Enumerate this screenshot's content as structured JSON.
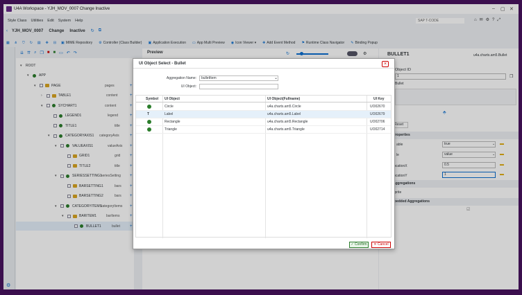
{
  "window": {
    "title": "U4A Workspace - YJH_MOV_0007 Change Inactive"
  },
  "menu": {
    "items": [
      "Style Class",
      "Utilities",
      "Edit",
      "System",
      "Help"
    ],
    "tcode_placeholder": "SAP T-CODE"
  },
  "subheader": {
    "app": "YJH_MOV_0007",
    "mode": "Change",
    "status": "Inactive"
  },
  "toolbar": {
    "items": [
      "MIME Repository",
      "Controller (Class Builder)",
      "Application Execution",
      "App Multi Preview",
      "Icon Viewer",
      "Add Event Method",
      "Runtime Class Navigator",
      "Binding Popup"
    ]
  },
  "tree": {
    "nodes": [
      {
        "label": "ROOT",
        "right": ""
      },
      {
        "label": "APP",
        "right": ""
      },
      {
        "label": "PAGE",
        "right": "pages"
      },
      {
        "label": "TABLE1",
        "right": "content"
      },
      {
        "label": "SYCHART1",
        "right": "content"
      },
      {
        "label": "LEGEND1",
        "right": "legend"
      },
      {
        "label": "TITLE1",
        "right": "title"
      },
      {
        "label": "CATEGORYAXIS1",
        "right": "categoryAxis"
      },
      {
        "label": "VALUEAXIS1",
        "right": "valueAxis"
      },
      {
        "label": "GRID1",
        "right": "grid"
      },
      {
        "label": "TITLE2",
        "right": "title"
      },
      {
        "label": "SERIESSETTING1",
        "right": "seriesSetting"
      },
      {
        "label": "BARSETTING1",
        "right": "bars"
      },
      {
        "label": "BARSETTING2",
        "right": "bars"
      },
      {
        "label": "CATEGORYITEMS",
        "right": "categoryItems"
      },
      {
        "label": "BARITEM1",
        "right": "barItems"
      },
      {
        "label": "BULLET1",
        "right": "bullet"
      }
    ]
  },
  "preview": {
    "title": "Preview"
  },
  "right_panel": {
    "title": "BULLET1",
    "class_name": "u4a.charts.am5.Bullet",
    "object_id_label": "Object ID",
    "object_id_value": "1",
    "sub_value": "Bullet",
    "reset_label": "Reset",
    "properties_label": "Properties",
    "props": [
      {
        "name": "able",
        "value": "true"
      },
      {
        "name": "le",
        "value": "value"
      },
      {
        "name": "locationX",
        "value": "0.5"
      },
      {
        "name": "locationY",
        "value": "1"
      }
    ],
    "aggregations_label": "Aggregations",
    "agg_item": "sprite",
    "embedded_label": "Embedded Aggregations"
  },
  "dialog": {
    "title": "UI Object Select - Bullet",
    "aggregation_label": "Aggregation Name:",
    "aggregation_value": "bulletItem",
    "uiobject_label": "UI Object:",
    "uiobject_value": "",
    "columns": [
      "Symbol",
      "UI Object",
      "UI Object(Fullname)",
      "UI Key"
    ],
    "rows": [
      {
        "symbol": "green-circle",
        "name": "Circle",
        "fullname": "u4a.charts.am5.Circle",
        "key": "UO02670"
      },
      {
        "symbol": "text-T",
        "name": "Label",
        "fullname": "u4a.charts.am5.Label",
        "key": "UO02679"
      },
      {
        "symbol": "green-circle",
        "name": "Rectangle",
        "fullname": "u4a.charts.am5.Rectangle",
        "key": "UO02706"
      },
      {
        "symbol": "green-circle",
        "name": "Triangle",
        "fullname": "u4a.charts.am5.Triangle",
        "key": "UO02714"
      }
    ],
    "confirm_label": "Confirm",
    "cancel_label": "Cancel"
  }
}
